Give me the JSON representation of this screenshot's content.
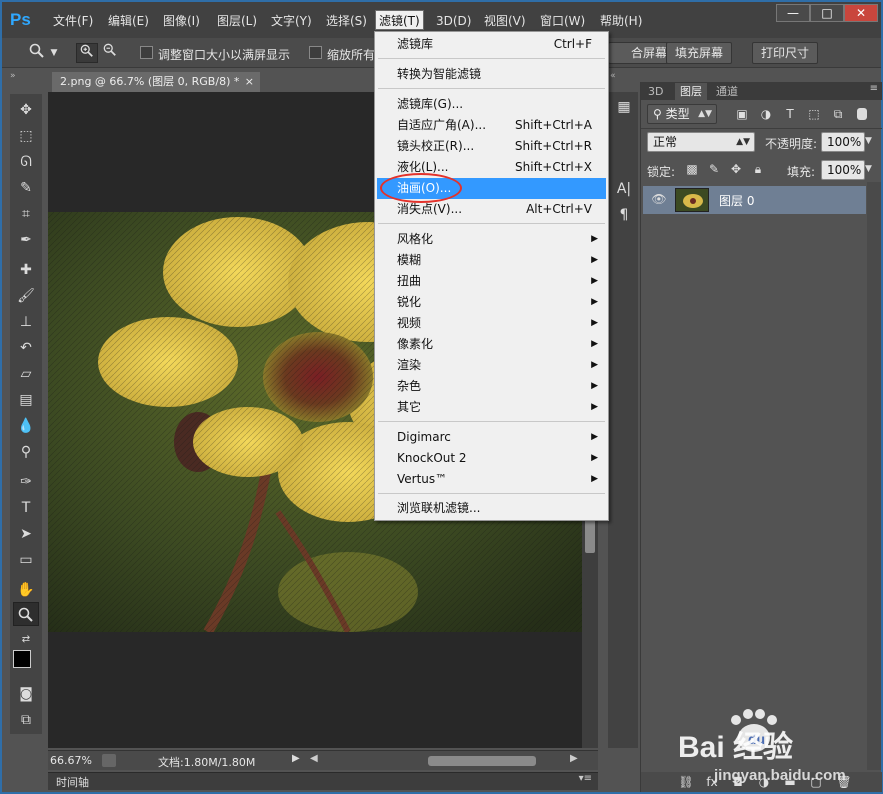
{
  "app": {
    "logo_text": "Ps"
  },
  "menubar": {
    "items": [
      {
        "label": "文件(F)"
      },
      {
        "label": "编辑(E)"
      },
      {
        "label": "图像(I)"
      },
      {
        "label": "图层(L)"
      },
      {
        "label": "文字(Y)"
      },
      {
        "label": "选择(S)"
      },
      {
        "label": "滤镜(T)"
      },
      {
        "label": "3D(D)"
      },
      {
        "label": "视图(V)"
      },
      {
        "label": "窗口(W)"
      },
      {
        "label": "帮助(H)"
      }
    ],
    "window_buttons": {
      "minimize": "—",
      "maximize": "□",
      "close": "✕"
    }
  },
  "options_bar": {
    "resize_windows_label": "调整窗口大小以满屏显示",
    "zoom_all_label": "缩放所有",
    "fit_screen_label": "合屏幕",
    "fill_screen_label": "填充屏幕",
    "print_size_label": "打印尺寸"
  },
  "document": {
    "tab_title": "2.png @ 66.7% (图层 0, RGB/8) *",
    "tab_close": "×",
    "zoom_level": "66.67%",
    "doc_info": "文档:1.80M/1.80M",
    "timeline_label": "时间轴"
  },
  "filter_menu": {
    "items": [
      {
        "label": "滤镜库",
        "shortcut": "Ctrl+F"
      },
      {
        "label": "转换为智能滤镜",
        "shortcut": ""
      },
      {
        "label": "滤镜库(G)...",
        "shortcut": ""
      },
      {
        "label": "自适应广角(A)...",
        "shortcut": "Shift+Ctrl+A"
      },
      {
        "label": "镜头校正(R)...",
        "shortcut": "Shift+Ctrl+R"
      },
      {
        "label": "液化(L)...",
        "shortcut": "Shift+Ctrl+X"
      },
      {
        "label": "油画(O)...",
        "shortcut": ""
      },
      {
        "label": "消失点(V)...",
        "shortcut": "Alt+Ctrl+V"
      },
      {
        "label": "风格化",
        "shortcut": ""
      },
      {
        "label": "模糊",
        "shortcut": ""
      },
      {
        "label": "扭曲",
        "shortcut": ""
      },
      {
        "label": "锐化",
        "shortcut": ""
      },
      {
        "label": "视频",
        "shortcut": ""
      },
      {
        "label": "像素化",
        "shortcut": ""
      },
      {
        "label": "渲染",
        "shortcut": ""
      },
      {
        "label": "杂色",
        "shortcut": ""
      },
      {
        "label": "其它",
        "shortcut": ""
      },
      {
        "label": "Digimarc",
        "shortcut": ""
      },
      {
        "label": "KnockOut 2",
        "shortcut": ""
      },
      {
        "label": "Vertus™",
        "shortcut": ""
      },
      {
        "label": "浏览联机滤镜...",
        "shortcut": ""
      }
    ],
    "highlight_color": "#3399ff",
    "annotation_color": "#e3322b"
  },
  "layers_panel": {
    "tabs": [
      {
        "label": "3D"
      },
      {
        "label": "图层"
      },
      {
        "label": "通道"
      }
    ],
    "filter_kind": "类型",
    "blend_mode": "正常",
    "opacity_label": "不透明度:",
    "opacity_value": "100%",
    "lock_label": "锁定:",
    "fill_label": "填充:",
    "fill_value": "100%",
    "layer_name": "图层 0"
  },
  "watermark": {
    "brand": "Bai 经验",
    "url": "jingyan.baidu.com"
  }
}
